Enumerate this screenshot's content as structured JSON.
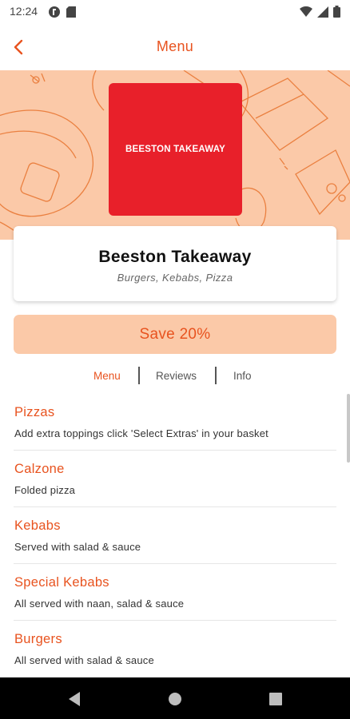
{
  "status_bar": {
    "time": "12:24",
    "icons_left": [
      "notification-icon",
      "sd-card-icon"
    ],
    "icons_right": [
      "wifi-icon",
      "signal-icon",
      "battery-icon"
    ]
  },
  "app_bar": {
    "title": "Menu",
    "back_icon": "chevron-left-icon"
  },
  "restaurant": {
    "logo_text": "BEESTON TAKEAWAY",
    "name": "Beeston Takeaway",
    "cuisine": "Burgers, Kebabs, Pizza"
  },
  "promo": {
    "label": "Save 20%"
  },
  "tabs": [
    {
      "label": "Menu",
      "active": true
    },
    {
      "label": "Reviews",
      "active": false
    },
    {
      "label": "Info",
      "active": false
    }
  ],
  "categories": [
    {
      "title": "Pizzas",
      "description": "Add extra toppings click 'Select Extras' in your basket"
    },
    {
      "title": "Calzone",
      "description": "Folded pizza"
    },
    {
      "title": "Kebabs",
      "description": "Served with salad & sauce"
    },
    {
      "title": "Special Kebabs",
      "description": "All served with naan, salad & sauce"
    },
    {
      "title": "Burgers",
      "description": "All served with salad & sauce"
    }
  ],
  "colors": {
    "accent": "#e8531f",
    "hero_bg": "#fbc9a8",
    "logo_bg": "#e8202a"
  },
  "nav_bar": {
    "icons": [
      "back-triangle-icon",
      "home-circle-icon",
      "recents-square-icon"
    ]
  }
}
